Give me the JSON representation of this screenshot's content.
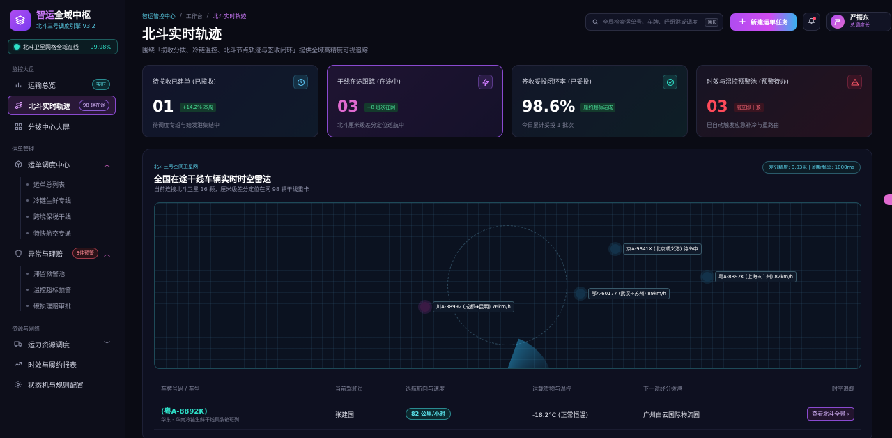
{
  "brand": {
    "title_accent": "智运",
    "title_rest": "全域中枢",
    "subtitle": "北斗三号调度引擎 V3.2"
  },
  "satellite": {
    "label": "北斗卫星网格全域在线",
    "value": "99.98%"
  },
  "sidebar": {
    "sections": [
      {
        "title": "监控大盘",
        "items": [
          {
            "label": "运输总览",
            "icon": "bar-chart-icon",
            "badge": "实时"
          },
          {
            "label": "北斗实时轨迹",
            "icon": "route-icon",
            "badge": "98 辆在途"
          },
          {
            "label": "分拨中心大屏",
            "icon": "grid-icon"
          }
        ]
      },
      {
        "title": "运单管理",
        "items": [
          {
            "label": "运单调度中心",
            "icon": "box-icon",
            "children": [
              "运单总列表",
              "冷链生鲜专线",
              "跨境保税干线",
              "特快航空专递"
            ]
          },
          {
            "label": "异常与理赔",
            "icon": "shield-icon",
            "badge": "3件预警",
            "children": [
              "滞留预警池",
              "温控超标预警",
              "破损理赔审批"
            ]
          }
        ]
      },
      {
        "title": "资源与网络",
        "items": [
          {
            "label": "运力资源调度",
            "icon": "truck-icon"
          },
          {
            "label": "时效与履约报表",
            "icon": "trend-icon"
          },
          {
            "label": "状态机与规则配置",
            "icon": "gear-icon"
          }
        ]
      }
    ]
  },
  "breadcrumb": [
    "智运管控中心",
    "/",
    "工作台",
    "/",
    "北斗实时轨迹"
  ],
  "page": {
    "title": "北斗实时轨迹",
    "description": "围绕「揽收分拨、冷链温控、北斗节点轨迹与签收闭环」提供全域高精度可视追踪"
  },
  "search": {
    "placeholder": "全局检索运单号、车牌、经纽港或调度",
    "shortcut": "⌘K"
  },
  "toolbar": {
    "new_task": "新建运单任务"
  },
  "user": {
    "initial": "严",
    "name": "严振东",
    "role": "总调度长"
  },
  "cards": [
    {
      "label": "待揽收已建单 (已揽收)",
      "value": "01",
      "badge": "+14.2% 本周",
      "foot": "待调度专班与始发港集结中",
      "icon": "clock-icon"
    },
    {
      "label": "干线在途跟踪 (在途中)",
      "value": "03",
      "badge": "+8 班次在网",
      "foot": "北斗厘米级差分定位巡航中",
      "icon": "bolt-icon"
    },
    {
      "label": "签收妥投闭环率 (已妥投)",
      "value": "98.6%",
      "badge": "履约超标达成",
      "foot": "今日累计妥投 1 批次",
      "icon": "check-icon"
    },
    {
      "label": "时效与温控预警池 (预警待办)",
      "value": "03",
      "badge": "需立即干预",
      "foot": "已自动触发应急补冷与重路由",
      "icon": "alert-icon"
    }
  ],
  "radar": {
    "kicker": "北斗三号空间卫星网",
    "title": "全国在途干线车辆实时时空雷达",
    "description": "当前连接北斗卫星 16 颗，厘米级差分定位在网 98 辆干线重卡",
    "precision": "差分精度: 0.03米 | 刷新频率: 1000ms",
    "vehicles": [
      {
        "label": "京A-9341X (北京顺义港) 待命中"
      },
      {
        "label": "粤A-8892K (上海➔广州) 82km/h"
      },
      {
        "label": "鄂A-60177 (武汉➔苏州) 89km/h"
      },
      {
        "label": "川A-38992 (成都➔昆明) 76km/h"
      }
    ]
  },
  "table": {
    "headers": [
      "车牌号码 / 车型",
      "当前驾驶员",
      "巡航航向与速度",
      "运载货物与温控",
      "下一途经分拨港",
      "时空追踪"
    ],
    "rows": [
      {
        "plate": "(粤A-8892K)",
        "route": "华东 - 华南冷链生鲜干线集装箱班列",
        "driver": "张建国",
        "speed": "82 公里/小时",
        "cargo": "-18.2°C (正常恒温)",
        "next_hub": "广州白云国际物流园",
        "action": "查看北斗全景 ›"
      }
    ]
  },
  "colors": {
    "accent": "#d07cff",
    "teal": "#2fe0c8",
    "alert": "#ff4a5a",
    "bg": "#0a0b14"
  }
}
